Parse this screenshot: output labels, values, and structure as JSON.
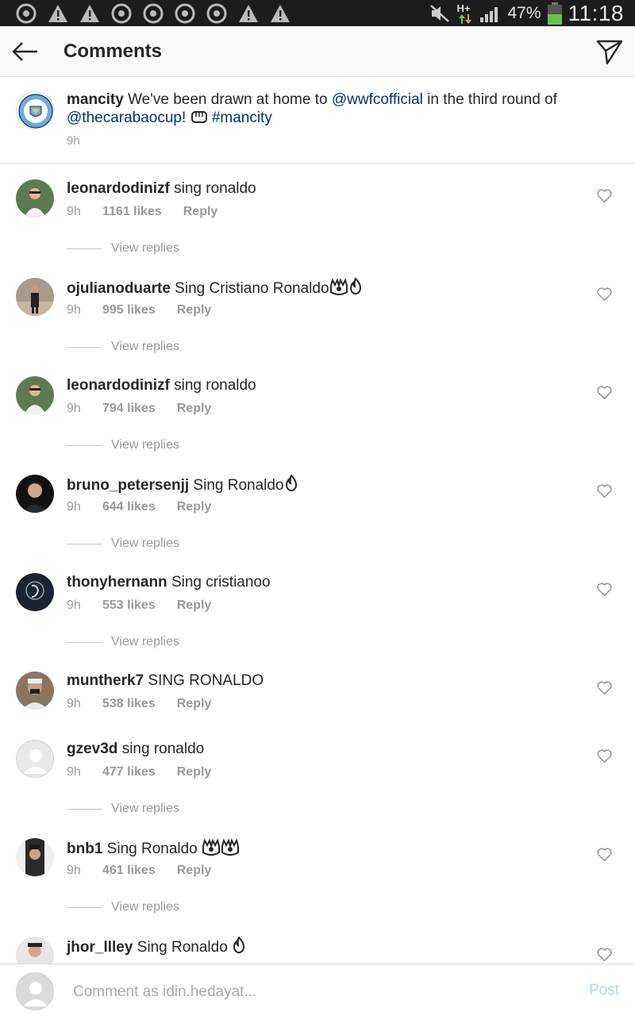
{
  "statusbar": {
    "notification_icons": [
      "chrome-icon",
      "warning-icon",
      "warning-icon",
      "chrome-icon",
      "chrome-icon",
      "chrome-icon",
      "chrome-icon",
      "warning-icon",
      "warning-icon"
    ],
    "network_label": "H+",
    "battery_percent": "47%",
    "time": "11:18"
  },
  "header": {
    "title": "Comments"
  },
  "caption": {
    "username": "mancity",
    "text_1": " We've been drawn at home to ",
    "mention_1": "@wwfcofficial",
    "text_2": " in the third round of ",
    "mention_2": "@thecarabaocup",
    "text_3": "! ",
    "hashtag": "#mancity",
    "time": "9h"
  },
  "comments": [
    {
      "username": "leonardodinizf",
      "text": " sing ronaldo",
      "time": "9h",
      "likes": "1161 likes",
      "reply": "Reply",
      "view_replies": "View replies",
      "emoji": ""
    },
    {
      "username": "ojulianoduarte",
      "text": " Sing Cristiano Ronaldo",
      "time": "9h",
      "likes": "995 likes",
      "reply": "Reply",
      "view_replies": "View replies",
      "emoji": "raised-hands-fire"
    },
    {
      "username": "leonardodinizf",
      "text": " sing ronaldo",
      "time": "9h",
      "likes": "794 likes",
      "reply": "Reply",
      "view_replies": "View replies",
      "emoji": ""
    },
    {
      "username": "bruno_petersenjj",
      "text": " Sing Ronaldo",
      "time": "9h",
      "likes": "644 likes",
      "reply": "Reply",
      "view_replies": "View replies",
      "emoji": "fire"
    },
    {
      "username": "thonyhernann",
      "text": " Sing cristianoo",
      "time": "9h",
      "likes": "553 likes",
      "reply": "Reply",
      "view_replies": "View replies",
      "emoji": ""
    },
    {
      "username": "muntherk7",
      "text": " SING RONALDO",
      "time": "9h",
      "likes": "538 likes",
      "reply": "Reply",
      "view_replies": "",
      "emoji": ""
    },
    {
      "username": "gzev3d",
      "text": " sing ronaldo",
      "time": "9h",
      "likes": "477 likes",
      "reply": "Reply",
      "view_replies": "View replies",
      "emoji": ""
    },
    {
      "username": "bnb1",
      "text": " Sing Ronaldo ",
      "time": "9h",
      "likes": "461 likes",
      "reply": "Reply",
      "view_replies": "View replies",
      "emoji": "raised-hands-x2"
    },
    {
      "username": "jhor_llley",
      "text": " Sing Ronaldo ",
      "time": "",
      "likes": "",
      "reply": "",
      "view_replies": "",
      "emoji": "fire"
    }
  ],
  "composer": {
    "placeholder": "Comment as idin.hedayat...",
    "post_label": "Post"
  },
  "colors": {
    "link": "#003569",
    "meta_gray": "#999999",
    "post_disabled": "#b3d5f5",
    "statusbar_bg": "#1c1c1c",
    "battery_green": "#6cc24a"
  }
}
